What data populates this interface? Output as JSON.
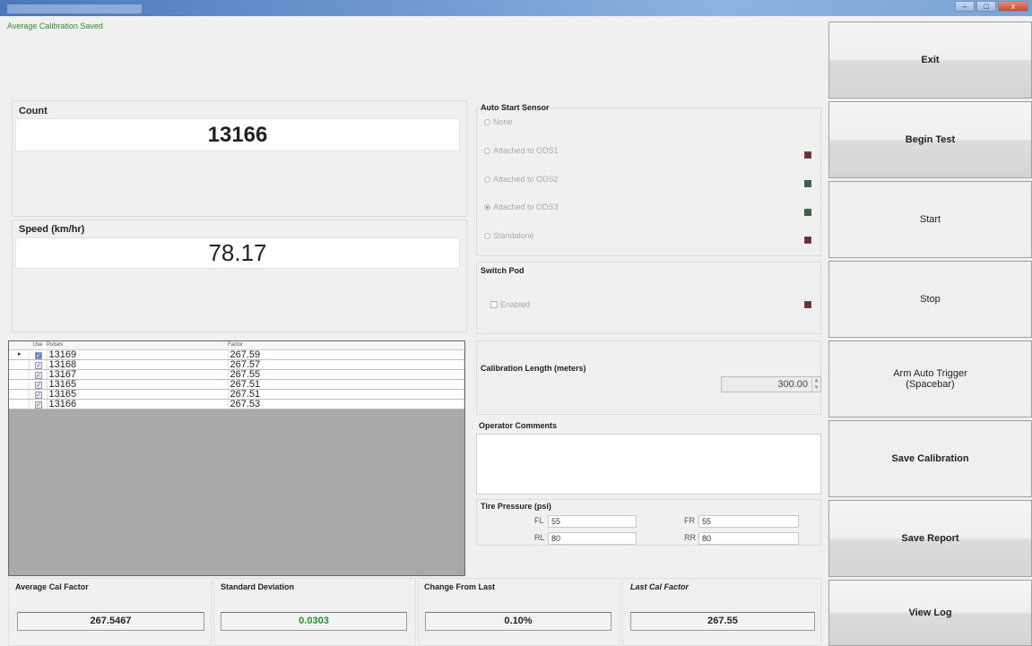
{
  "window": {
    "controls": [
      "–",
      "□",
      "x"
    ]
  },
  "status_message": "Average Calibration Saved",
  "count": {
    "label": "Count",
    "value": "13166"
  },
  "speed": {
    "label": "Speed (km/hr)",
    "value": "78.17"
  },
  "auto_start": {
    "label": "Auto Start Sensor",
    "options": [
      {
        "label": "None",
        "selected": false
      },
      {
        "label": "Attached to ODS1",
        "selected": false,
        "led": "red"
      },
      {
        "label": "Attached to ODS2",
        "selected": false,
        "led": "green"
      },
      {
        "label": "Attached to ODS3",
        "selected": true,
        "led": "green"
      },
      {
        "label": "Standalone",
        "selected": false,
        "led": "red"
      }
    ]
  },
  "switch_pod": {
    "label": "Switch Pod",
    "checkbox_label": "Enabled",
    "enabled": false,
    "led": "red"
  },
  "grid": {
    "headers": [
      "Use",
      "Pulses",
      "Factor"
    ],
    "rows": [
      {
        "pulses": "13169",
        "factor": "267.59",
        "use": true,
        "current": true
      },
      {
        "pulses": "13168",
        "factor": "267.57",
        "use": true,
        "current": false
      },
      {
        "pulses": "13167",
        "factor": "267.55",
        "use": true,
        "current": false
      },
      {
        "pulses": "13165",
        "factor": "267.51",
        "use": true,
        "current": false
      },
      {
        "pulses": "13165",
        "factor": "267.51",
        "use": true,
        "current": false
      },
      {
        "pulses": "13166",
        "factor": "267.53",
        "use": true,
        "current": false
      }
    ]
  },
  "calibration_length": {
    "label": "Calibration Length  (meters)",
    "value": "300.00"
  },
  "operator_comments": {
    "label": "Operator Comments",
    "value": ""
  },
  "tire_pressure": {
    "label": "Tire Pressure (psi)",
    "FL": {
      "label": "FL",
      "value": "55"
    },
    "FR": {
      "label": "FR",
      "value": "55"
    },
    "RL": {
      "label": "RL",
      "value": "80"
    },
    "RR": {
      "label": "RR",
      "value": "80"
    }
  },
  "stats": {
    "avg_cal_factor": {
      "label": "Average Cal Factor",
      "value": "267.5467"
    },
    "std_dev": {
      "label": "Standard Deviation",
      "value": "0.0303",
      "color": "#2e8b2e"
    },
    "change_from_last": {
      "label": "Change From Last",
      "value": "0.10%"
    },
    "last_cal_factor": {
      "label": "Last Cal Factor",
      "value": "267.55"
    }
  },
  "buttons": {
    "exit": "Exit",
    "begin_test": "Begin Test",
    "start": "Start",
    "stop": "Stop",
    "arm_line1": "Arm Auto Trigger",
    "arm_line2": "(Spacebar)",
    "save_calibration": "Save Calibration",
    "save_report": "Save Report",
    "view_log": "View Log"
  },
  "colors": {
    "status_green": "#2e8b2e",
    "led_red": "#7a2a2a",
    "led_green": "#2f6b3a"
  }
}
